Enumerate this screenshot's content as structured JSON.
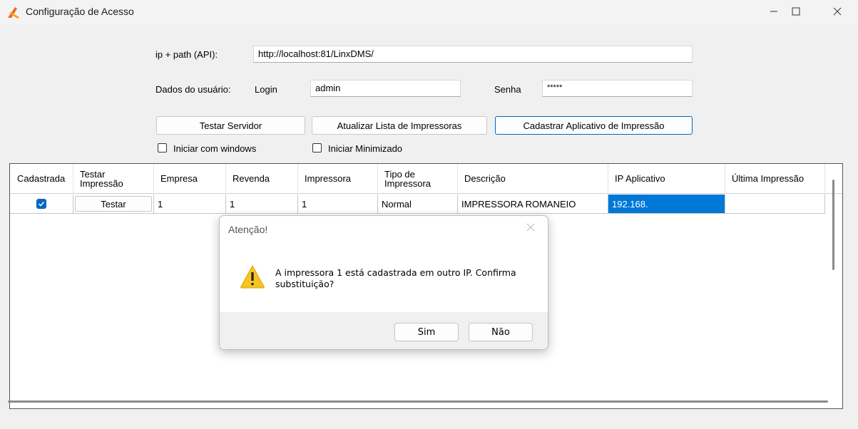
{
  "window": {
    "title": "Configuração de Acesso"
  },
  "form": {
    "api_label": "ip + path (API):",
    "api_value": "http://localhost:81/LinxDMS/",
    "user_label": "Dados do usuário:",
    "login_label": "Login",
    "login_value": "admin",
    "password_label": "Senha",
    "password_value": "*****",
    "btn_test_server": "Testar Servidor",
    "btn_update_printers": "Atualizar Lista de Impressoras",
    "btn_register_app": "Cadastrar Aplicativo de Impressão",
    "chk_start_windows": "Iniciar com windows",
    "chk_start_minimized": "Iniciar Minimizado"
  },
  "grid": {
    "columns": [
      "Cadastrada",
      "Testar Impressão",
      "Empresa",
      "Revenda",
      "Impressora",
      "Tipo de Impressora",
      "Descrição",
      "IP Aplicativo",
      "Última Impressão"
    ],
    "rows": [
      {
        "cadastrada": true,
        "testar": "Testar",
        "empresa": "1",
        "revenda": "1",
        "impressora": "1",
        "tipo": "Normal",
        "descricao": "IMPRESSORA ROMANEIO",
        "ip": "192.168.",
        "ultima": ""
      }
    ]
  },
  "dialog": {
    "title": "Atenção!",
    "message": "A impressora 1 está cadastrada em outro IP. Confirma substituição?",
    "yes": "Sim",
    "no": "Não"
  },
  "colors": {
    "accent": "#0078d7",
    "warning": "#f7c325"
  }
}
